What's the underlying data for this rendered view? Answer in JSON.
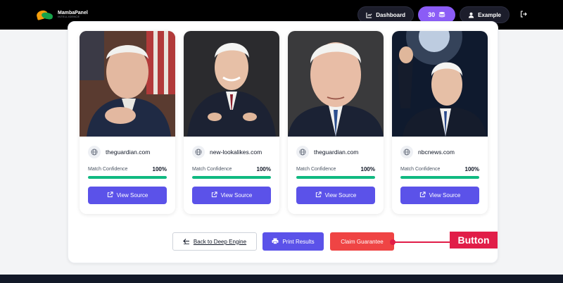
{
  "header": {
    "logo_title": "MambaPanel",
    "logo_subtitle": "INTELLIGENCE",
    "dashboard_label": "Dashboard",
    "credits": "30",
    "user_label": "Example"
  },
  "results": [
    {
      "source": "theguardian.com",
      "match_label": "Match Confidence",
      "match_value": "100%",
      "match_fraction": 1.0,
      "button_label": "View Source"
    },
    {
      "source": "new-lookalikes.com",
      "match_label": "Match Confidence",
      "match_value": "100%",
      "match_fraction": 1.0,
      "button_label": "View Source"
    },
    {
      "source": "theguardian.com",
      "match_label": "Match Confidence",
      "match_value": "100%",
      "match_fraction": 1.0,
      "button_label": "View Source"
    },
    {
      "source": "nbcnews.com",
      "match_label": "Match Confidence",
      "match_value": "100%",
      "match_fraction": 1.0,
      "button_label": "View Source"
    }
  ],
  "actions": {
    "back_label": "Back to Deep Engine",
    "print_label": "Print Results",
    "claim_label": "Claim Guarantee"
  },
  "annotation": {
    "label": "Button",
    "color": "#e11d48"
  },
  "colors": {
    "accent": "#5b52e9",
    "credits": "#8b5cf6",
    "danger": "#ef4444",
    "success": "#10b981"
  },
  "icons": [
    "chart-icon",
    "coins-icon",
    "user-icon",
    "logout-icon",
    "globe-icon",
    "external-link-icon",
    "arrow-left-icon",
    "printer-icon"
  ]
}
